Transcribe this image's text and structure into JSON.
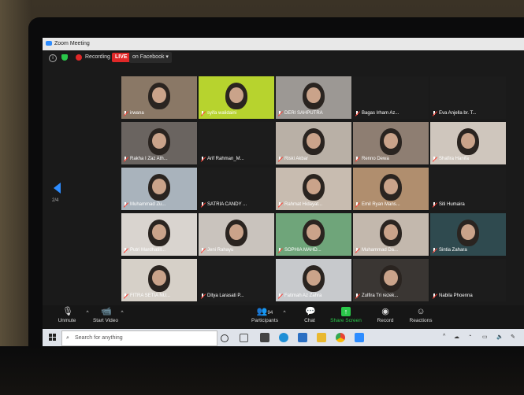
{
  "window": {
    "title": "Zoom Meeting"
  },
  "infobar": {
    "recording": "Recording",
    "live": "LIVE",
    "stream_target": "on Facebook"
  },
  "pager": {
    "page": "2/4"
  },
  "participants": [
    {
      "name": "irwana",
      "photo": "#8a7866"
    },
    {
      "name": "syifa walidaini",
      "photo": "#b7d32e"
    },
    {
      "name": "DERI SAHPUTRA",
      "photo": "#9c9894"
    },
    {
      "name": "Bagas Irham Az...",
      "photo": "#1c1c1c"
    },
    {
      "name": "Eva Anjella br. T...",
      "photo": "#1c1c1c"
    },
    {
      "name": "Rakha I Zaz Ath...",
      "photo": "#6a6460"
    },
    {
      "name": "Arif Rahman_M...",
      "photo": "#1c1c1c"
    },
    {
      "name": "Riski Akbar",
      "photo": "#b9b0a6"
    },
    {
      "name": "Renno Dewa",
      "photo": "#8e7e72"
    },
    {
      "name": "Shafira Hanifa",
      "photo": "#cfc6bd"
    },
    {
      "name": "Muhammad Zu...",
      "photo": "#a9b3bc"
    },
    {
      "name": "SATRIA CANDY ...",
      "photo": "#1c1c1c"
    },
    {
      "name": "Rahmat Hidayat...",
      "photo": "#c8bcb0"
    },
    {
      "name": "Emil Ryan Mans...",
      "photo": "#b08e6e"
    },
    {
      "name": "Siti Humaira",
      "photo": "#1c1c1c"
    },
    {
      "name": "Putri Mardhatill...",
      "photo": "#d9d4cf"
    },
    {
      "name": "Jeni Rahayu",
      "photo": "#c9c3bd"
    },
    {
      "name": "SOPHIA MAHD...",
      "photo": "#6fa57a"
    },
    {
      "name": "Muhammad Da...",
      "photo": "#c3b8ad"
    },
    {
      "name": "Sintia Zahara",
      "photo": "#2f4a4f"
    },
    {
      "name": "FITRA SETIA NU...",
      "photo": "#d6d0c8"
    },
    {
      "name": "Ditya Larasati P...",
      "photo": "#1c1c1c"
    },
    {
      "name": "Fatimah Az Zahra",
      "photo": "#c7c9cc"
    },
    {
      "name": "Zulfira Tri rezek...",
      "photo": "#3a3633"
    },
    {
      "name": "Nabila Phoenna",
      "photo": "#1c1c1c"
    }
  ],
  "toolbar": {
    "unmute": "Unmute",
    "start_video": "Start Video",
    "participants": "Participants",
    "participants_count": "94",
    "chat": "Chat",
    "share_screen": "Share Screen",
    "record": "Record",
    "reactions": "Reactions"
  },
  "taskbar": {
    "search_placeholder": "Search for anything"
  },
  "colors": {
    "accent": "#2d8cff",
    "share": "#2ac84a",
    "live": "#e02828"
  }
}
